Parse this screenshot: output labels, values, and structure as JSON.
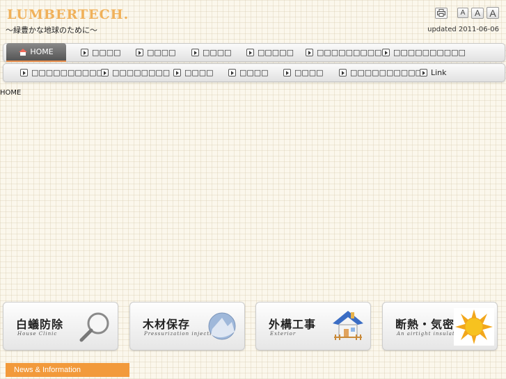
{
  "header": {
    "logo": "LUMBERTECH.",
    "tagline": "～緑豊かな地球のために～",
    "updated": "updated 2011-06-06",
    "font_size_buttons": [
      "A",
      "A",
      "A"
    ]
  },
  "nav_row1": [
    {
      "label": "HOME"
    },
    {
      "label": "□□□□"
    },
    {
      "label": "□□□□"
    },
    {
      "label": "□□□□"
    },
    {
      "label": "□□□□□"
    },
    {
      "label": "□□□□□□□□□"
    },
    {
      "label": "□□□□□□□□□□"
    }
  ],
  "nav_row2": [
    {
      "label": "□□□□□□□□□□"
    },
    {
      "label": "□□□□□□□□"
    },
    {
      "label": "□□□□"
    },
    {
      "label": "□□□□"
    },
    {
      "label": "□□□□"
    },
    {
      "label": "□□□□□□□□□□"
    },
    {
      "label": "Link"
    }
  ],
  "breadcrumb": "HOME",
  "banners": [
    {
      "title": "白蟻防除",
      "subtitle": "House Clinic",
      "icon": "magnifier-icon"
    },
    {
      "title": "木材保存",
      "subtitle": "Pressurization injection",
      "icon": "wood-globe-icon"
    },
    {
      "title": "外構工事",
      "subtitle": "Exterior",
      "icon": "house-icon"
    },
    {
      "title": "断熱・気密",
      "subtitle": "An airtight insulation",
      "icon": "sun-icon"
    }
  ],
  "news": {
    "title": "News & Information"
  },
  "colors": {
    "accent_orange": "#f29a3b",
    "logo": "#f0b15a",
    "home_icon": "#ee6b5b"
  }
}
